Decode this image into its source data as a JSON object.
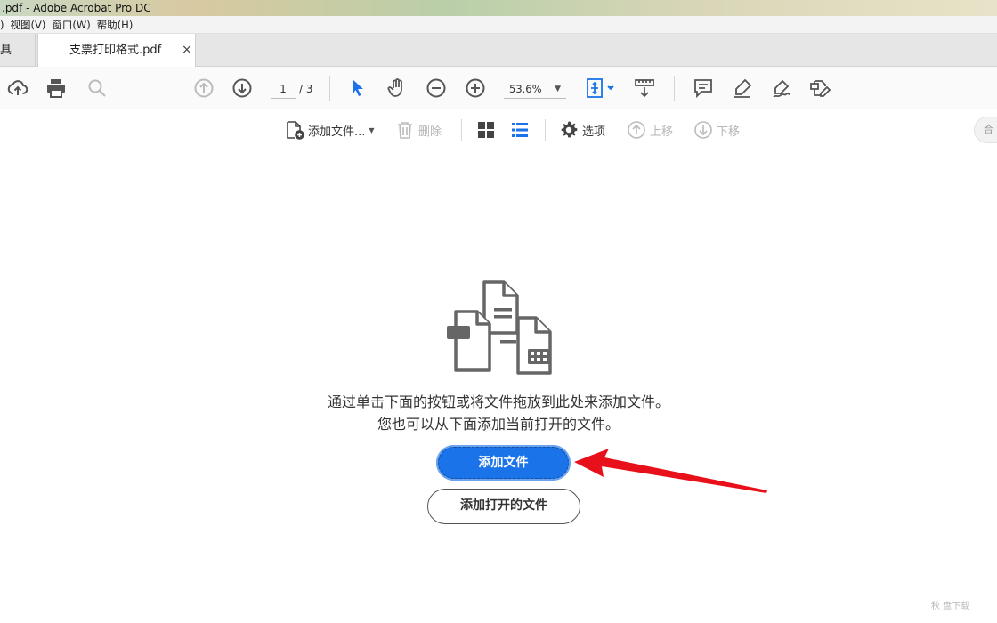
{
  "window": {
    "title": ".pdf - Adobe Acrobat Pro DC"
  },
  "menu": {
    "items": [
      ")",
      "视图(V)",
      "窗口(W)",
      "帮助(H)"
    ]
  },
  "tabs": {
    "tools_label": "具",
    "doc_label": "支票打印格式.pdf",
    "close_glyph": "×"
  },
  "toolbar": {
    "page_current": "1",
    "page_total": "/ 3",
    "zoom": "53.6%",
    "zoom_caret": "▼",
    "accent": "#1a73e8"
  },
  "toolbar2": {
    "add_files_label": "添加文件...",
    "add_files_caret": "▼",
    "delete_label": "删除",
    "options_label": "选项",
    "move_up_label": "上移",
    "move_down_label": "下移",
    "right_pill": "合"
  },
  "main": {
    "message_line1": "通过单击下面的按钮或将文件拖放到此处来添加文件。",
    "message_line2": "您也可以从下面添加当前打开的文件。",
    "add_files_button": "添加文件",
    "add_open_files_button": "添加打开的文件"
  },
  "colors": {
    "primary_button": "#1a73e8",
    "arrow": "#e8101a"
  },
  "watermark": "秋 盘下载"
}
